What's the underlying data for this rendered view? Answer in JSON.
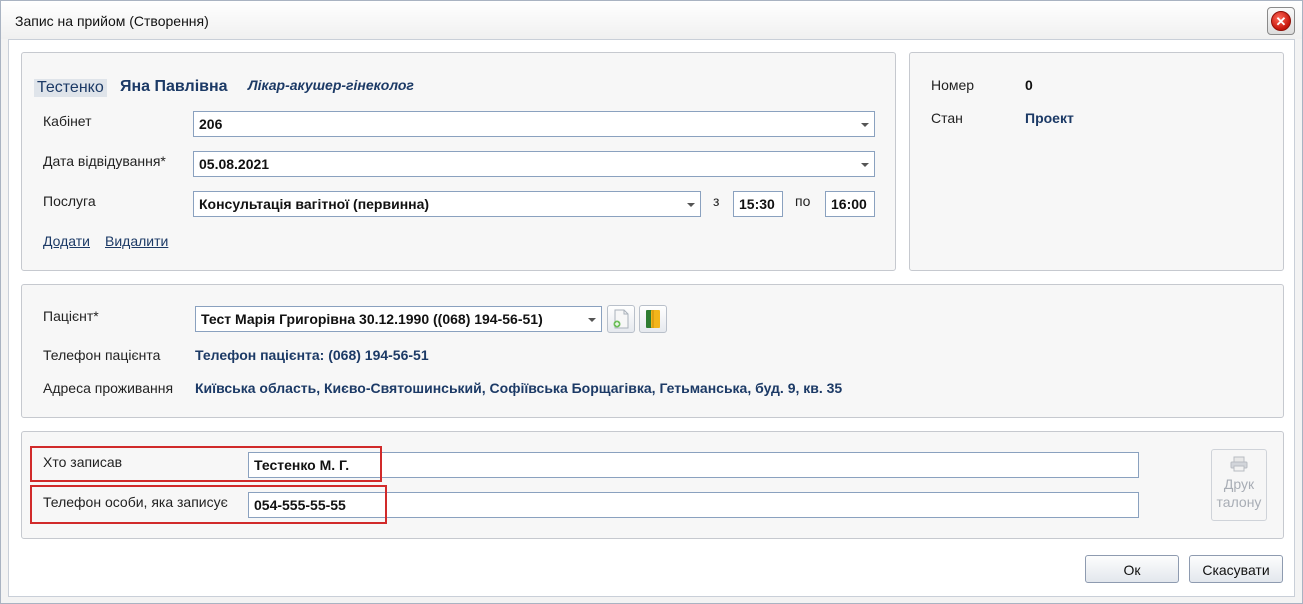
{
  "window": {
    "title": "Запис на прийом (Створення)"
  },
  "doctor": {
    "surname": "Тестенко",
    "name": "Яна Павлівна",
    "specialty": "Лікар-акушер-гінеколог"
  },
  "appointment": {
    "cabinet_label": "Кабінет",
    "cabinet_value": "206",
    "date_label": "Дата відвідування*",
    "date_value": "05.08.2021",
    "service_label": "Послуга",
    "service_value": "Консультація вагітної (первинна)",
    "from_label": "з",
    "from_value": "15:30",
    "to_label": "по",
    "to_value": "16:00",
    "add_link": "Додати",
    "delete_link": "Видалити"
  },
  "status": {
    "number_label": "Номер",
    "number_value": "0",
    "state_label": "Стан",
    "state_value": "Проект"
  },
  "patient": {
    "patient_label": "Пацієнт*",
    "patient_value": "Тест Марія Григорівна 30.12.1990 ((068) 194-56-51)",
    "phone_label": "Телефон пацієнта",
    "phone_value": "Телефон пацієнта: (068) 194-56-51",
    "address_label": "Адреса проживання",
    "address_value": "Київська область, Києво-Святошинський, Софіївська Борщагівка, Гетьманська, буд. 9, кв. 35"
  },
  "recorder": {
    "who_label": "Хто записав",
    "who_value": "Тестенко М. Г.",
    "phone_label": "Телефон особи, яка записує",
    "phone_value": "054-555-55-55",
    "print_label_1": "Друк",
    "print_label_2": "талону"
  },
  "footer": {
    "ok_label": "Ок",
    "cancel_label": "Скасувати"
  },
  "icons": {
    "close": "close-icon",
    "new_patient": "add-patient-icon",
    "patient_card": "patient-card-icon",
    "print": "printer-icon"
  },
  "colors": {
    "accent_text": "#1c3a66",
    "highlight": "#d12a2a",
    "close_red": "#c5140a"
  }
}
